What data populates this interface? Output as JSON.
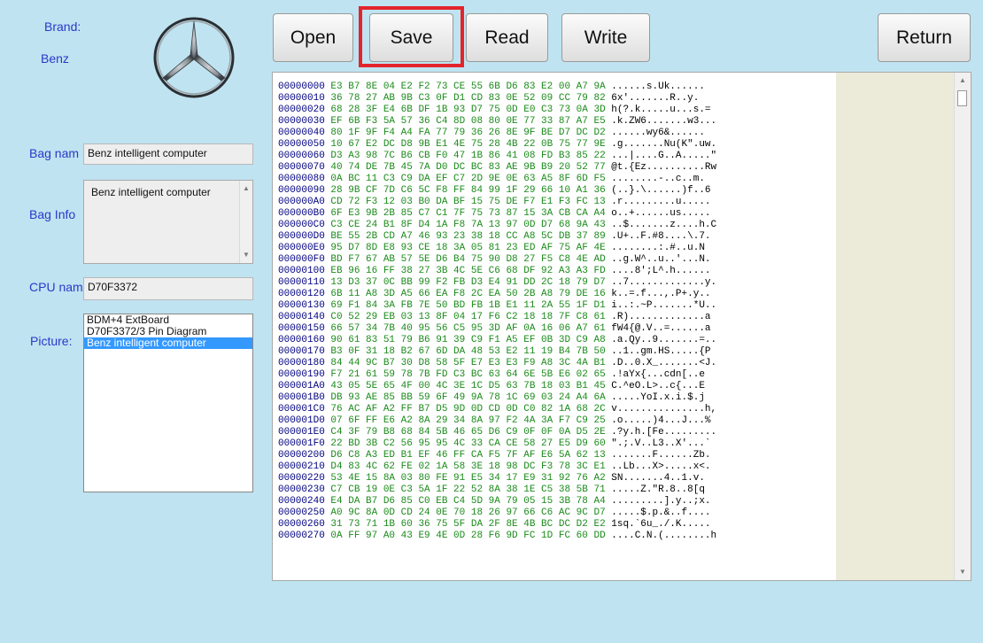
{
  "brand": {
    "label": "Brand:",
    "value": "Benz"
  },
  "bag_name": {
    "label": "Bag nam",
    "value": "Benz intelligent computer"
  },
  "bag_info": {
    "label": "Bag Info",
    "value": "Benz intelligent computer"
  },
  "cpu_name": {
    "label": "CPU nam",
    "value": "D70F3372"
  },
  "picture": {
    "label": "Picture:",
    "items": [
      "BDM+4 ExtBoard",
      "D70F3372/3 Pin Diagram",
      "Benz intelligent computer"
    ],
    "selected": 2
  },
  "toolbar": {
    "open": "Open",
    "save": "Save",
    "read": "Read",
    "write": "Write",
    "return": "Return"
  },
  "highlight_color": "#e3242b",
  "hex": {
    "offsets": [
      "00000000",
      "00000010",
      "00000020",
      "00000030",
      "00000040",
      "00000050",
      "00000060",
      "00000070",
      "00000080",
      "00000090",
      "000000A0",
      "000000B0",
      "000000C0",
      "000000D0",
      "000000E0",
      "000000F0",
      "00000100",
      "00000110",
      "00000120",
      "00000130",
      "00000140",
      "00000150",
      "00000160",
      "00000170",
      "00000180",
      "00000190",
      "000001A0",
      "000001B0",
      "000001C0",
      "000001D0",
      "000001E0",
      "000001F0",
      "00000200",
      "00000210",
      "00000220",
      "00000230",
      "00000240",
      "00000250",
      "00000260",
      "00000270"
    ],
    "bytes": [
      "E3 B7 8E 04 E2 F2 73 CE 55 6B D6 83 E2 00 A7 9A",
      "36 78 27 AB 9B C3 0F D1 CD 83 0E 52 09 CC 79 82",
      "68 28 3F E4 6B DF 1B 93 D7 75 0D E0 C3 73 0A 3D",
      "EF 6B F3 5A 57 36 C4 8D 08 80 0E 77 33 87 A7 E5",
      "80 1F 9F F4 A4 FA 77 79 36 26 8E 9F BE D7 DC D2",
      "10 67 E2 DC D8 9B E1 4E 75 28 4B 22 0B 75 77 9E",
      "D3 A3 98 7C B6 CB F0 47 1B 86 41 08 FD B3 85 22",
      "40 74 DE 7B 45 7A D0 DC BC 83 AE 9B B9 20 52 77",
      "0A BC 11 C3 C9 DA EF C7 2D 9E 0E 63 A5 8F 6D F5",
      "28 9B CF 7D C6 5C F8 FF 84 99 1F 29 66 10 A1 36",
      "CD 72 F3 12 03 B0 DA BF 15 75 DE F7 E1 F3 FC 13",
      "6F E3 9B 2B 85 C7 C1 7F 75 73 87 15 3A CB CA A4",
      "C3 CE 24 B1 8F D4 1A F8 7A 13 97 0D D7 68 9A 43",
      "BE 55 2B CD A7 46 93 23 38 18 CC A8 5C DB 37 89",
      "95 D7 8D E8 93 CE 18 3A 05 81 23 ED AF 75 AF 4E",
      "BD F7 67 AB 57 5E D6 B4 75 90 D8 27 F5 C8 4E AD",
      "EB 96 16 FF 38 27 3B 4C 5E C6 68 DF 92 A3 A3 FD",
      "13 D3 37 0C BB 99 F2 FB D3 E4 91 DD 2C 18 79 D7",
      "6B 11 A8 3D A5 66 EA F8 2C EA 50 2B A8 79 DE 16",
      "69 F1 84 3A FB 7E 50 BD FB 1B E1 11 2A 55 1F D1",
      "C0 52 29 EB 03 13 8F 04 17 F6 C2 18 18 7F C8 61",
      "66 57 34 7B 40 95 56 C5 95 3D AF 0A 16 06 A7 61",
      "90 61 83 51 79 B6 91 39 C9 F1 A5 EF 0B 3D C9 A8",
      "B3 0F 31 18 B2 67 6D DA 48 53 E2 11 19 B4 7B 50",
      "84 44 9C B7 30 D8 58 5F E7 E3 E3 F9 A8 3C 4A B1",
      "F7 21 61 59 78 7B FD C3 BC 63 64 6E 5B E6 02 65",
      "43 05 5E 65 4F 00 4C 3E 1C D5 63 7B 18 03 B1 45",
      "DB 93 AE 85 BB 59 6F 49 9A 78 1C 69 03 24 A4 6A",
      "76 AC AF A2 FF B7 D5 9D 0D CD 0D C0 82 1A 68 2C",
      "07 6F FF E6 A2 8A 29 34 8A 97 F2 4A 3A F7 C9 25",
      "C4 3F 79 B8 68 84 5B 46 65 D6 C9 0F 0F 0A D5 2E",
      "22 BD 3B C2 56 95 95 4C 33 CA CE 58 27 E5 D9 60",
      "D6 C8 A3 ED B1 EF 46 FF CA F5 7F AF E6 5A 62 13",
      "D4 83 4C 62 FE 02 1A 58 3E 18 98 DC F3 78 3C E1",
      "53 4E 15 8A 03 80 FE 91 E5 34 17 E9 31 92 76 A2",
      "C7 CB 19 0E C3 5A 1F 22 52 8A 38 1E C5 38 5B 71",
      "E4 DA B7 D6 85 C0 EB C4 5D 9A 79 05 15 3B 78 A4",
      "A0 9C 8A 0D CD 24 0E 70 18 26 97 66 C6 AC 9C D7",
      "31 73 71 1B 60 36 75 5F DA 2F 8E 4B BC DC D2 E2",
      "0A FF 97 A0 43 E9 4E 0D 28 F6 9D FC 1D FC 60 DD"
    ],
    "ascii": [
      "......s.Uk......",
      "6x'.......R..y.",
      "h(?.k.....u...s.=",
      ".k.ZW6.......w3...",
      "......wy6&......",
      ".g.......Nu(K\".uw.",
      "...|....G..A.....\"",
      "@t.{Ez..........Rw",
      "........-..c..m.",
      "(..}.\\......)f..6",
      ".r.........u.....",
      "o..+......us.....",
      "..$.......z....h.C",
      ".U+..F.#8....\\.7.",
      "........:.#..u.N",
      "..g.W^..u..'...N.",
      "....8';L^.h......",
      "..7.............y.",
      "k..=.f...,.P+.y..",
      "i..:.~P.......*U..",
      ".R).............a",
      "fW4{@.V..=......a",
      ".a.Qy..9.......=..",
      "..1..gm.HS.....{P",
      ".D..0.X_.......<J.",
      ".!aYx{...cdn[..e",
      "C.^eO.L>..c{...E",
      ".....YoI.x.i.$.j",
      "v...............h,",
      ".o.....)4...J...%",
      ".?y.h.[Fe.........",
      "\".;.V..L3..X'...`",
      ".......F......Zb.",
      "..Lb...X>.....x<.",
      "SN.......4..1.v.",
      ".....Z.\"R.8..8[q",
      ".........].y..;x.",
      ".....$.p.&..f....",
      "1sq.`6u_./.K.....",
      "....C.N.(........h"
    ]
  }
}
